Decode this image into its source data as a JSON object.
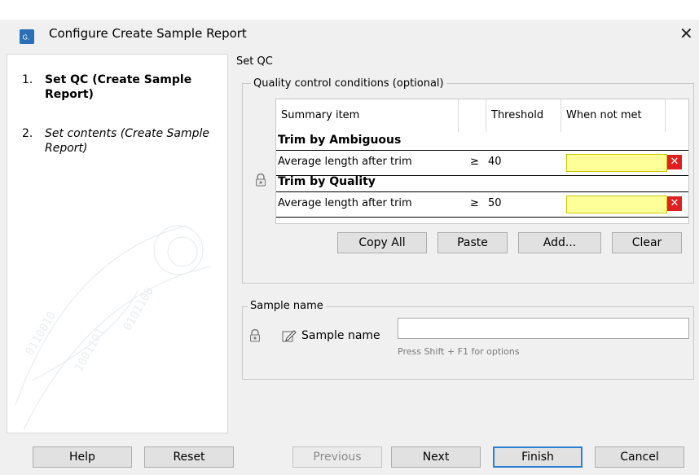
{
  "window": {
    "title": "Configure Create Sample Report",
    "app_icon": "clc-app-icon",
    "close_icon": "close-icon"
  },
  "steps": [
    {
      "number": "1.",
      "label": "Set QC (Create Sample Report)",
      "active": true
    },
    {
      "number": "2.",
      "label": "Set contents (Create Sample Report)",
      "active": false
    }
  ],
  "section": {
    "title": "Set QC"
  },
  "qc_group": {
    "title": "Quality control conditions (optional)",
    "headers": [
      "Summary item",
      "",
      "Threshold",
      "When not met",
      ""
    ],
    "rows": [
      {
        "type": "category",
        "label": "Trim by Ambiguous"
      },
      {
        "type": "item",
        "label": "Average length after trim",
        "op": "≥",
        "threshold": "40",
        "when_not_met": ""
      },
      {
        "type": "category",
        "label": "Trim by Quality"
      },
      {
        "type": "item",
        "label": "Average length after trim",
        "op": "≥",
        "threshold": "50",
        "when_not_met": ""
      }
    ],
    "buttons": {
      "copy_all": "Copy All",
      "paste": "Paste",
      "add": "Add...",
      "clear": "Clear"
    }
  },
  "sample_group": {
    "title": "Sample name",
    "field_label": "Sample name",
    "value": "",
    "hint": "Press Shift + F1 for options"
  },
  "footer": {
    "help": "Help",
    "reset": "Reset",
    "previous": "Previous",
    "next": "Next",
    "finish": "Finish",
    "cancel": "Cancel"
  },
  "colors": {
    "warning_fill": "#ffff99",
    "delete_red": "#e02020",
    "focus_blue": "#2d7fd3"
  }
}
